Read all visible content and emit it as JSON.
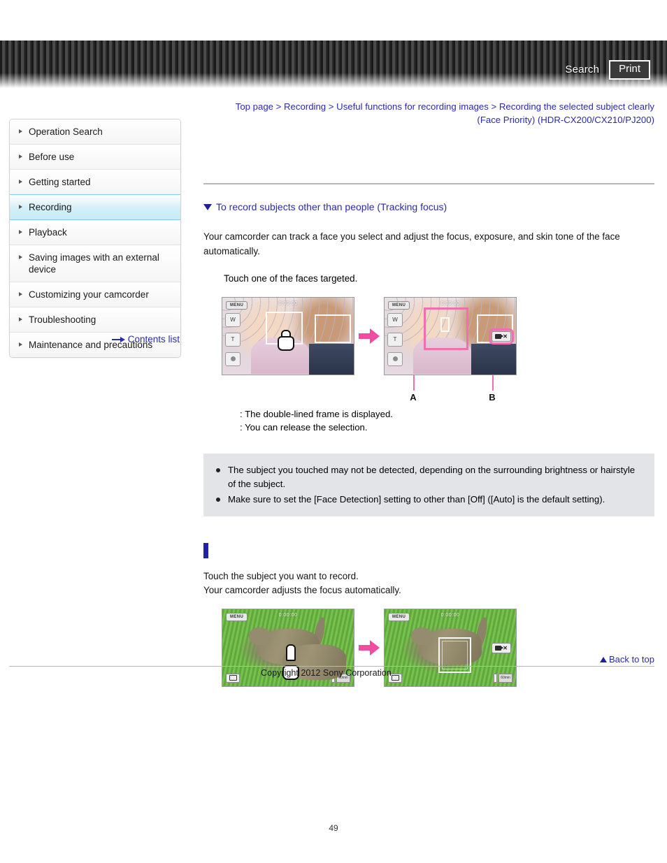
{
  "header": {
    "search_label": "Search",
    "print_label": "Print"
  },
  "breadcrumb": {
    "line1": "Top page > Recording > Useful functions for recording images > Recording the selected subject clearly",
    "line2": "(Face Priority) (HDR-CX200/CX210/PJ200)"
  },
  "sidebar": {
    "items": [
      {
        "label": "Operation Search",
        "active": false
      },
      {
        "label": "Before use",
        "active": false
      },
      {
        "label": "Getting started",
        "active": false
      },
      {
        "label": "Recording",
        "active": true
      },
      {
        "label": "Playback",
        "active": false
      },
      {
        "label": "Saving images with an external device",
        "active": false
      },
      {
        "label": "Customizing your camcorder",
        "active": false
      },
      {
        "label": "Troubleshooting",
        "active": false
      },
      {
        "label": "Maintenance and precautions",
        "active": false
      }
    ],
    "contents_list_label": "Contents list"
  },
  "main": {
    "section_heading": "To record subjects other than people (Tracking focus)",
    "intro_paragraph": "Your camcorder can track a face you select and adjust the focus, exposure, and skin tone of the face automatically.",
    "step_text": "Touch one of the faces targeted.",
    "figure1": {
      "left_shot": {
        "menu_label": "MENU",
        "time_label": "0:00:00",
        "zoom_wide": "W",
        "zoom_tele": "T"
      },
      "right_shot": {
        "menu_label": "MENU",
        "time_label": "0:00:00",
        "zoom_wide": "W",
        "zoom_tele": "T",
        "release_chip_x": "✕"
      },
      "callout_a": "A",
      "callout_b": "B"
    },
    "legend": [
      {
        "key": "",
        "text": ": The double-lined frame is displayed."
      },
      {
        "key": "",
        "text": ": You can release the selection."
      }
    ],
    "notes": [
      "The subject you touched may not be detected, depending on the surrounding brightness or hairstyle of the subject.",
      "Make sure to set the [Face Detection] setting to other than [Off] ([Auto] is the default setting)."
    ],
    "lower_line1": "Touch the subject you want to record.",
    "lower_line2": "Your camcorder adjusts the focus automatically.",
    "figure2": {
      "left_shot": {
        "menu_label": "MENU",
        "time_label": "0:00:00",
        "battery_label": "60min"
      },
      "right_shot": {
        "menu_label": "MENU",
        "time_label": "0:00:00",
        "battery_label": "60min",
        "release_chip_x": "✕"
      }
    }
  },
  "footer": {
    "back_to_top_label": "Back to top",
    "copyright": "Copyright 2012 Sony Corporation",
    "page_number": "49"
  },
  "colors": {
    "link": "#2a2ab0",
    "accent_pink": "#f06fb0",
    "active_nav": "#c5ebf6",
    "note_bg": "#e2e4e8",
    "marker_blue": "#2222a8"
  }
}
